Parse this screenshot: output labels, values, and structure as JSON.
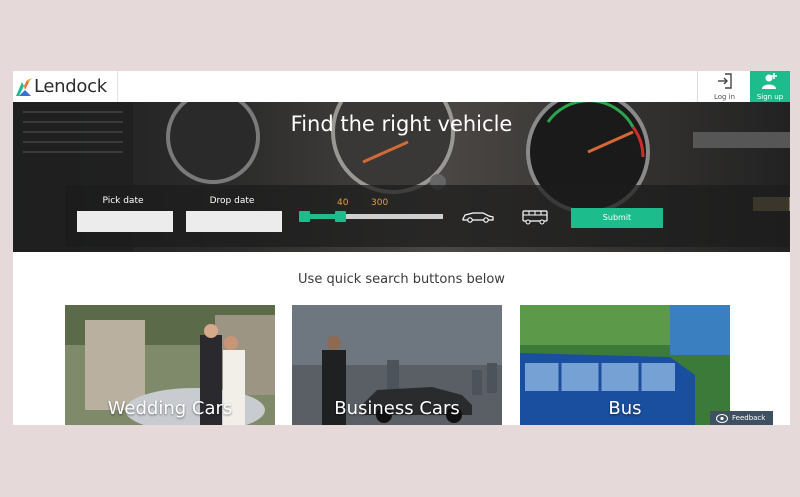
{
  "header": {
    "logo_text": "Lendock",
    "login_label": "Log in",
    "signup_label": "Sign up"
  },
  "hero": {
    "title": "Find the right vehicle"
  },
  "search": {
    "pick_date_label": "Pick date",
    "pick_date_value": "",
    "drop_date_label": "Drop date",
    "drop_date_value": "",
    "slider_min_label": "40",
    "slider_max_label": "300",
    "vehicle_types": [
      "car-icon",
      "bus-icon"
    ],
    "submit_label": "Submit"
  },
  "quick": {
    "title": "Use quick search buttons below",
    "cards": [
      {
        "label": "Wedding Cars"
      },
      {
        "label": "Business Cars"
      },
      {
        "label": "Bus"
      }
    ]
  },
  "feedback": {
    "label": "Feedback"
  },
  "colors": {
    "accent": "#1dbc8c",
    "slider_value": "#e59a3c",
    "page_bg": "#e6d9da",
    "feedback_bg": "#3f5061"
  }
}
